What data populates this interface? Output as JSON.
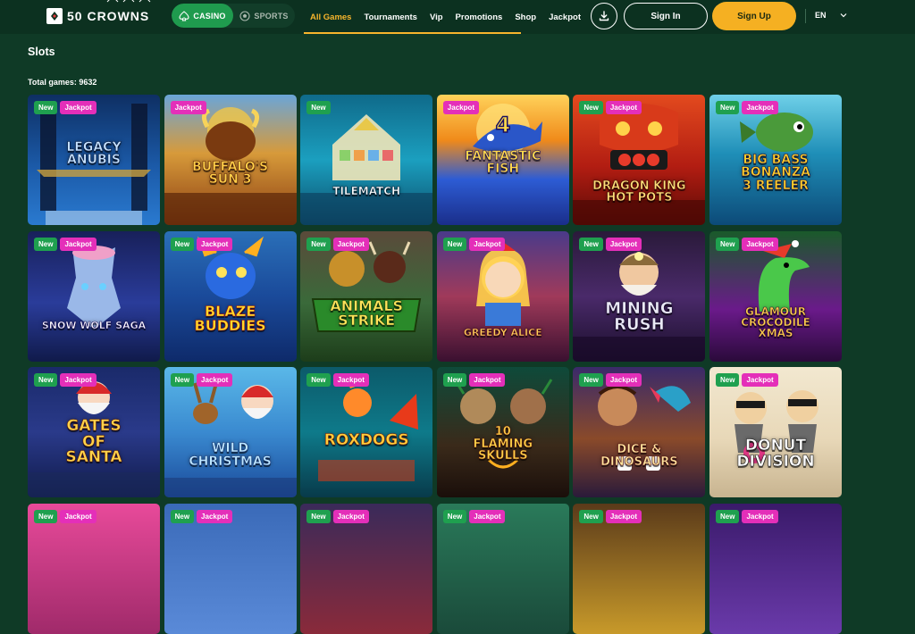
{
  "header": {
    "logo_text": "50 CROWNS",
    "verticals": {
      "casino": "CASINO",
      "sports": "SPORTS"
    },
    "nav": [
      "All Games",
      "Tournaments",
      "Vip",
      "Promotions",
      "Shop",
      "Jackpot"
    ],
    "active_nav": "All Games",
    "download_icon": "download-icon",
    "sign_in": "Sign In",
    "sign_up": "Sign Up",
    "language": "EN"
  },
  "colors": {
    "background": "#0f3a26",
    "header": "#0c3120",
    "accent": "#f7b52c",
    "casino_green": "#1f9b4e",
    "new_badge": "#1fa04f",
    "jackpot_badge": "#e42fb9"
  },
  "page": {
    "title": "Slots",
    "total_games": "Total games: 9632"
  },
  "badge_labels": {
    "new": "New",
    "jackpot": "Jackpot"
  },
  "games": [
    {
      "title": "LEGACY\nANUBIS",
      "new": true,
      "jackpot": true
    },
    {
      "title": "BUFFALO'S\nSUN 3",
      "new": false,
      "jackpot": true
    },
    {
      "title": "TILEMATCH",
      "new": true,
      "jackpot": false
    },
    {
      "title": "FANTASTIC\nFISH",
      "new": false,
      "jackpot": true
    },
    {
      "title": "DRAGON KING\nHOT POTS",
      "new": true,
      "jackpot": true
    },
    {
      "title": "BIG BASS\nBONANZA\n3 REELER",
      "new": true,
      "jackpot": true
    },
    {
      "title": "SNOW WOLF SAGA",
      "new": true,
      "jackpot": true
    },
    {
      "title": "BLAZE\nBUDDIES",
      "new": true,
      "jackpot": true
    },
    {
      "title": "ANIMALS\nSTRIKE",
      "new": true,
      "jackpot": true
    },
    {
      "title": "GREEDY ALICE",
      "new": true,
      "jackpot": true
    },
    {
      "title": "MINING\nRUSH",
      "new": true,
      "jackpot": true
    },
    {
      "title": "GLAMOUR\nCROCODILE\nXMAS",
      "new": true,
      "jackpot": true
    },
    {
      "title": "GATES\nOF\nSANTA",
      "new": true,
      "jackpot": true
    },
    {
      "title": "WILD\nCHRISTMAS",
      "new": true,
      "jackpot": true
    },
    {
      "title": "ROXDOGS",
      "new": true,
      "jackpot": true
    },
    {
      "title": "10\nFLAMING\nSKULLS",
      "new": true,
      "jackpot": true
    },
    {
      "title": "DICE &\nDINOSAURS",
      "new": true,
      "jackpot": true
    },
    {
      "title": "DONUT\nDIVISION",
      "new": true,
      "jackpot": true
    },
    {
      "title": "",
      "new": true,
      "jackpot": true
    },
    {
      "title": "",
      "new": true,
      "jackpot": true
    },
    {
      "title": "",
      "new": true,
      "jackpot": true
    },
    {
      "title": "",
      "new": true,
      "jackpot": true
    },
    {
      "title": "",
      "new": true,
      "jackpot": true
    },
    {
      "title": "",
      "new": true,
      "jackpot": true
    }
  ]
}
